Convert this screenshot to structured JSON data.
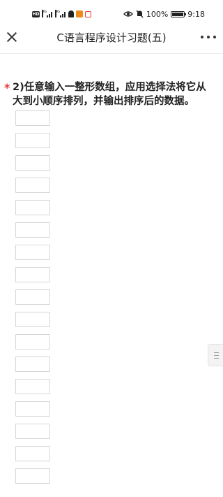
{
  "status_bar": {
    "hd_badge": "HD",
    "net1": "4G",
    "net2": "4G",
    "battery_text": "100%",
    "battery_level": 1.0,
    "time": "9:18"
  },
  "header": {
    "title": "C语言程序设计习题(五)",
    "close_icon": "close-icon",
    "more_icon": "more-horizontal-icon"
  },
  "question": {
    "required_mark": "*",
    "text": "2)任意输入一整形数组，应用选择法将它从大到小顺序排列，并输出排序后的数据。"
  },
  "answers": [
    {
      "value": ""
    },
    {
      "value": ""
    },
    {
      "value": ""
    },
    {
      "value": ""
    },
    {
      "value": ""
    },
    {
      "value": ""
    },
    {
      "value": ""
    },
    {
      "value": ""
    },
    {
      "value": ""
    },
    {
      "value": ""
    },
    {
      "value": ""
    },
    {
      "value": ""
    },
    {
      "value": ""
    },
    {
      "value": ""
    },
    {
      "value": ""
    },
    {
      "value": ""
    },
    {
      "value": ""
    }
  ],
  "colors": {
    "required": "#e03c3c",
    "border": "#d6d6d6"
  }
}
